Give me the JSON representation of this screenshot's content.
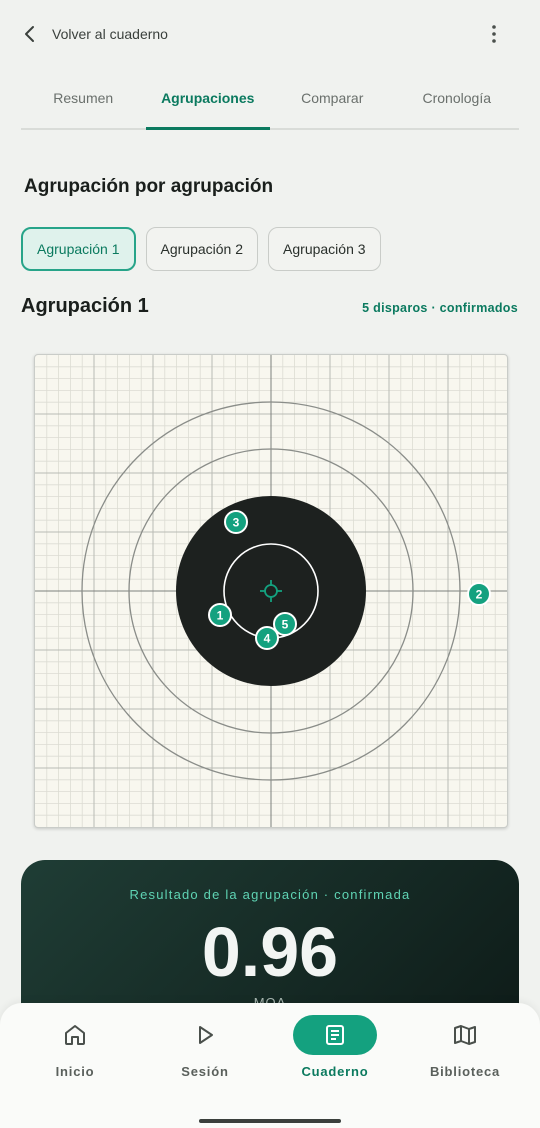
{
  "header": {
    "back_label": "Volver al cuaderno"
  },
  "tabs": [
    {
      "label": "Resumen"
    },
    {
      "label": "Agrupaciones"
    },
    {
      "label": "Comparar"
    },
    {
      "label": "Cronología"
    }
  ],
  "active_tab": "Agrupaciones",
  "section": {
    "title": "Agrupación por agrupación"
  },
  "chips": [
    {
      "label": "Agrupación 1"
    },
    {
      "label": "Agrupación 2"
    },
    {
      "label": "Agrupación 3"
    }
  ],
  "selected_chip": "Agrupación 1",
  "group": {
    "title": "Agrupación 1",
    "status": "5 disparos · confirmados"
  },
  "target": {
    "shots": [
      {
        "label": "1"
      },
      {
        "label": "2"
      },
      {
        "label": "3"
      },
      {
        "label": "4"
      },
      {
        "label": "5"
      }
    ]
  },
  "result": {
    "label": "Resultado de la agrupación · confirmada",
    "value": "0.96",
    "unit": "MOA"
  },
  "nav": [
    {
      "label": "Inicio",
      "icon": "home-icon"
    },
    {
      "label": "Sesión",
      "icon": "play-icon"
    },
    {
      "label": "Cuaderno",
      "icon": "notebook-icon"
    },
    {
      "label": "Biblioteca",
      "icon": "map-icon"
    }
  ],
  "active_nav": "Cuaderno",
  "colors": {
    "accent": "#0b7a5f",
    "marker": "#14a17f",
    "card_dark": "#0e1b18"
  }
}
